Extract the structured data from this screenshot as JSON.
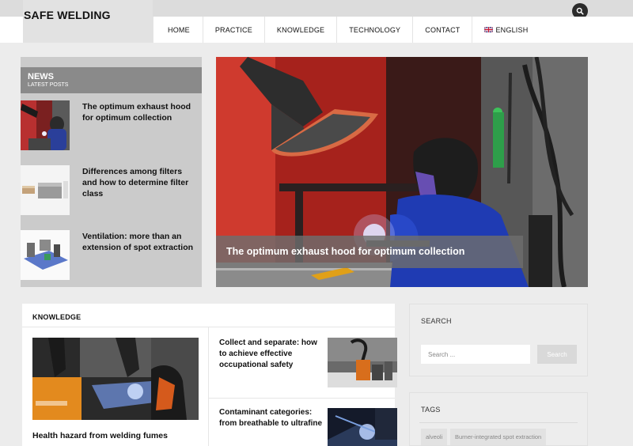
{
  "header": {
    "logo": "SAFE WELDING",
    "nav": [
      "HOME",
      "PRACTICE",
      "KNOWLEDGE",
      "TECHNOLOGY",
      "CONTACT"
    ],
    "language": "ENGLISH"
  },
  "news": {
    "title": "NEWS",
    "subtitle": "LATEST POSTS",
    "items": [
      "The optimum exhaust hood for optimum collection",
      "Differences among filters and how to determine filter class",
      "Ventilation: more than an extension of spot extraction"
    ]
  },
  "hero": {
    "caption": "The optimum exhaust hood for optimum collection"
  },
  "knowledge": {
    "title": "KNOWLEDGE",
    "featured": "Health hazard from welding fumes",
    "items": [
      "Collect and separate: how to achieve effective occupational safety",
      "Contaminant categories: from breathable to ultrafine"
    ]
  },
  "search_widget": {
    "title": "SEARCH",
    "placeholder": "Search ...",
    "button": "Search"
  },
  "tags_widget": {
    "title": "TAGS",
    "tags": [
      "alveoli",
      "Burner-integrated spot extraction"
    ]
  }
}
